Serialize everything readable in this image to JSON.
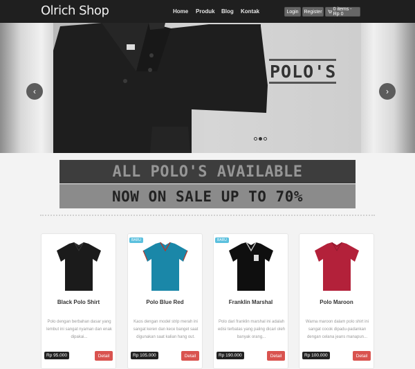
{
  "brand": "Olrich Shop",
  "nav": {
    "links": [
      "Home",
      "Produk",
      "Blog",
      "Kontak"
    ],
    "login": "Login",
    "register": "Register",
    "cart_label": "0 items - Rp 0"
  },
  "hero": {
    "headline": "POLO'S",
    "prev_icon": "‹",
    "next_icon": "›"
  },
  "promo": {
    "line1": "ALL POLO'S AVAILABLE",
    "line2": "NOW ON SALE UP TO 70%"
  },
  "products": [
    {
      "name": "Black Polo Shirt",
      "badge": "",
      "description": "Polo dengan berbahan dasar yang lembut ini sangat nyaman dan enak dipakai...",
      "price": "Rp 95.000",
      "button": "Detail",
      "shirt_color": "#1b1b1b",
      "collar_color": "#1b1b1b"
    },
    {
      "name": "Polo Blue Red",
      "badge": "BARU",
      "description": "Kaos dengan model strip merah ini sangat keren dan kece banget saat digunakan saat kalian hang out.",
      "price": "Rp 105.000",
      "button": "Detail",
      "shirt_color": "#1a87a8",
      "collar_color": "#b23a2e"
    },
    {
      "name": "Franklin Marshal",
      "badge": "BARU",
      "description": "Polo dari franklin marshal ini adalah edisi terbatas yang paling dicari oleh banyak orang...",
      "price": "Rp 190.000",
      "button": "Detail",
      "shirt_color": "#0f0f0f",
      "collar_color": "#c9c9c9"
    },
    {
      "name": "Polo Maroon",
      "badge": "",
      "description": "Warna maroon dalam polo shirt ini sangat cocok dipadu-padankan dengan celana jeans manapun...",
      "price": "Rp 100.000",
      "button": "Detail",
      "shirt_color": "#b3213a",
      "collar_color": "#b3213a"
    }
  ]
}
